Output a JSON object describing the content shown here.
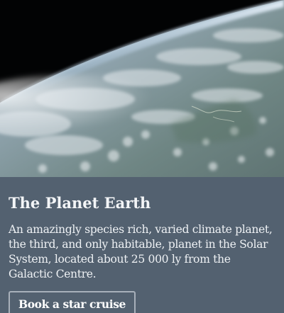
{
  "card": {
    "image_alt": "earth-from-space-image",
    "title": "The Planet Earth",
    "description": "An amazingly species rich, varied climate planet, the third, and only habitable, planet in the Solar System, located about 25 000 ly from the Galactic Centre.",
    "button_label": "Book a star cruise"
  },
  "colors": {
    "card_background": "#536170",
    "text": "#f3f5f7",
    "button_border": "#a8b0ba"
  }
}
